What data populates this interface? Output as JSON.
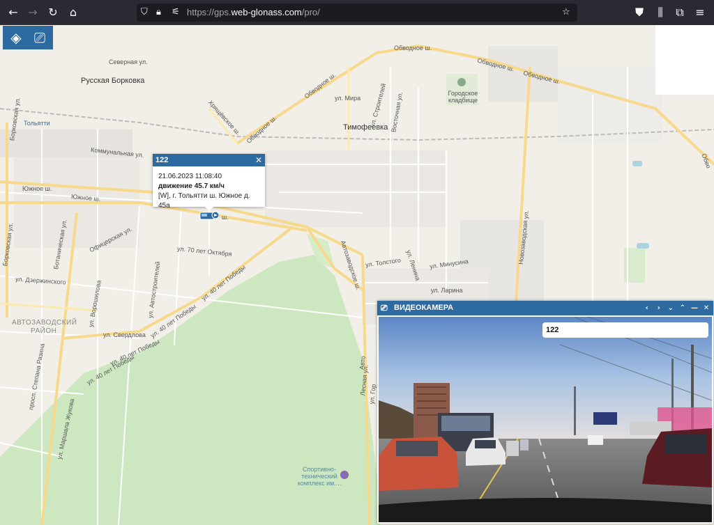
{
  "browser": {
    "url_prefix": "https://gps.",
    "url_host": "web-glonass.com",
    "url_path": "/pro/",
    "icons": [
      "back-arrow-icon",
      "forward-arrow-icon",
      "reload-icon",
      "home-icon",
      "shield-icon",
      "lock-icon",
      "permissions-icon",
      "bookmark-star-icon",
      "pocket-icon",
      "library-icon",
      "extensions-icon",
      "menu-icon"
    ]
  },
  "map": {
    "labels": {
      "russkaya_borkovka": "Русская Борковка",
      "togliatti_station": "Тольятти",
      "timofeevka": "Тимофеевка",
      "gorodskoe_kladbishche": "Городское кладбище",
      "avtozavodsky": "АВТОЗАВОДСКИЙ",
      "rayon": "РАЙОН",
      "sport_complex": "Спортивно-технический комплекс им....",
      "severnaya": "Северная ул.",
      "kommunalnaya": "Коммунальная ул.",
      "yuzhnoe_1": "Южное ш.",
      "yuzhnoe_2": "Южное ш.",
      "yuzhnoe_3": "ш.",
      "obvodnoe_1": "Обводное ш.",
      "obvodnoe_2": "Обводное ш.",
      "obvodnoe_3": "Обводное ш.",
      "obvodnoe_4": "Обводное ш.",
      "obvodnoe_5": "Обводное ш.",
      "obvodnoe_6": "Обво",
      "khryashchevoe": "Хрящёвское ш.",
      "mira": "ул. Мира",
      "stroiteley": "ул. Строителей",
      "vostochnaya": "Восточная ул.",
      "borkovskaya_1": "Борковская ул.",
      "borkovskaya_2": "Борковская ул.",
      "botanicheskaya": "Ботаническая ул.",
      "oficerskaya": "Офицерская ул.",
      "let70_oktyabrya": "ул. 70 лет Октября",
      "let40_pobedy_1": "ул. 40 лет Победы",
      "let40_pobedy_2": "ул. 40 лет Победы",
      "let40_pobedy_3": "ул. 40 лет Победы",
      "let40_pobedy_4": "ул. 40 лет Победы",
      "dzerzhinskogo": "ул. Дзержинского",
      "voroshilova": "ул. Ворошилова",
      "avtostroiteley": "ул. Автостроителей",
      "sverdlova": "ул. Свердлова",
      "stepana_razina": "просп. Степана Разина",
      "marshala_zhukova": "ул. Маршала Жукова",
      "avtozavodskoe_sh": "Автозаводское ш.",
      "tolstogo": "ул. Толстого",
      "lenina": "ул. Ленина",
      "minusina": "ул. Минусина",
      "larina": "ул. Ларина",
      "novozavodskaya": "Новозаводская ул.",
      "lesnaya": "Лесная ул.",
      "avtozavodskoe_short": "Авто",
      "gor": "ул. Гор"
    }
  },
  "layer_controls": {
    "layers_icon": "layers-icon",
    "camera_icon": "video-camera-icon"
  },
  "popup": {
    "title": "122",
    "datetime": "21.06.2023 11:08:40",
    "status": "движение 45.7 км/ч",
    "address": "[W], г. Тольятти ш. Южное д. 45а",
    "close": "✕"
  },
  "camera_panel": {
    "title": "ВИДЕОКАМЕРА",
    "controls": [
      "‹",
      "›",
      "⌄",
      "⌃",
      "—",
      "✕"
    ],
    "overlay_label": "122"
  },
  "colors": {
    "panel_blue": "#2d6aa0",
    "road_major": "#f7d98c",
    "forest_green": "#cde8c0",
    "map_bg": "#f2efe9"
  }
}
